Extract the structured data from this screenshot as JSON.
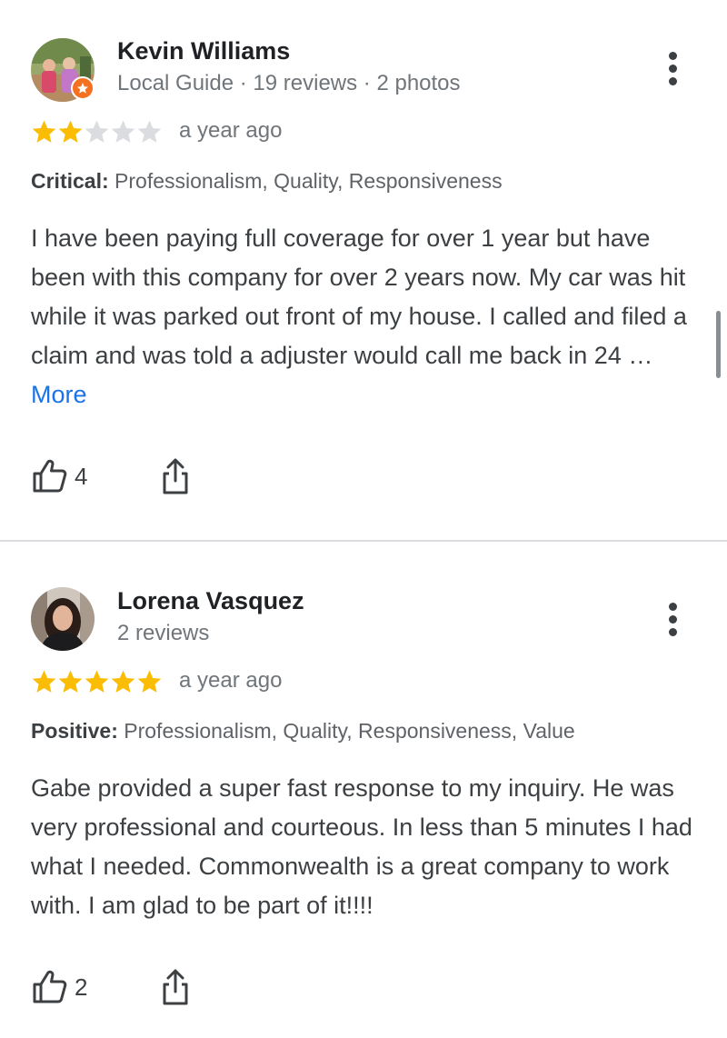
{
  "reviews": [
    {
      "name": "Kevin Williams",
      "subline": "Local Guide · 19 reviews · 2 photos",
      "rating": 2,
      "max_rating": 5,
      "date": "a year ago",
      "attribute_label": "Critical:",
      "attribute_values": "Professionalism, Quality, Responsiveness",
      "text": "I have been paying full coverage for over 1 year but have been with this company for over 2 years now. My car was hit while it was parked out front of my house. I called and filed a claim and was told a adjuster would call me back in 24 … ",
      "more_label": "More",
      "likes": "4",
      "local_guide": true
    },
    {
      "name": "Lorena Vasquez",
      "subline": "2 reviews",
      "rating": 5,
      "max_rating": 5,
      "date": "a year ago",
      "attribute_label": "Positive:",
      "attribute_values": "Professionalism, Quality, Responsiveness, Value",
      "text": "Gabe provided a super fast response to my inquiry. He was very professional and courteous. In less than 5 minutes I had what I needed. Commonwealth is a great company to work with. I am glad to be part of it!!!!",
      "more_label": "",
      "likes": "2",
      "local_guide": false
    }
  ],
  "icons": {
    "more": "more-vert-icon",
    "like": "thumb-up-icon",
    "share": "share-icon",
    "star": "star-icon",
    "local_guide": "local-guide-badge-icon"
  },
  "colors": {
    "star_filled": "#fbbc04",
    "star_empty": "#dadce0",
    "link": "#1a73e8",
    "local_guide_badge": "#f37121"
  }
}
